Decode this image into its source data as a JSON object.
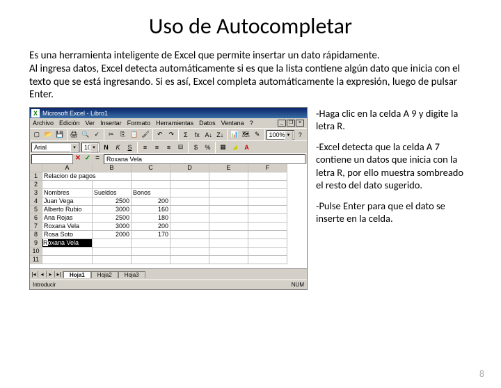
{
  "title": "Uso de Autocompletar",
  "intro": "Es una herramienta inteligente de Excel que permite insertar un dato rápidamente.\nAl ingresa datos, Excel detecta automáticamente si es que la lista contiene algún dato que inicia con el texto que se está ingresando. Si es así, Excel completa automáticamente la expresión, luego de pulsar Enter.",
  "notes": {
    "n1": "-Haga clic en la celda A 9 y digite la letra R.",
    "n2": "-Excel detecta que la celda A 7 contiene un datos que inicia con la letra R, por ello muestra sombreado el resto del dato sugerido.",
    "n3": "-Pulse Enter para que el dato se inserte en la celda."
  },
  "page": "8",
  "excel": {
    "titlebar": "Microsoft Excel - Libro1",
    "menu": [
      "Archivo",
      "Edición",
      "Ver",
      "Insertar",
      "Formato",
      "Herramientas",
      "Datos",
      "Ventana",
      "?"
    ],
    "font": "Arial",
    "fontsize": "10",
    "formula": "Roxana Vela",
    "namebox": "",
    "cols": [
      "A",
      "B",
      "C",
      "D",
      "E",
      "F"
    ],
    "rows": [
      {
        "n": "1",
        "A": "Relacion de pagos"
      },
      {
        "n": "2"
      },
      {
        "n": "3",
        "A": "Nombres",
        "B": "Sueldos",
        "C": "Bonos"
      },
      {
        "n": "4",
        "A": "Juan Vega",
        "B": "2500",
        "C": "200"
      },
      {
        "n": "5",
        "A": "Alberto Rubio",
        "B": "3000",
        "C": "160"
      },
      {
        "n": "6",
        "A": "Ana Rojas",
        "B": "2500",
        "C": "180"
      },
      {
        "n": "7",
        "A": "Roxana Vela",
        "B": "3000",
        "C": "200"
      },
      {
        "n": "8",
        "A": "Rosa Soto",
        "B": "2000",
        "C": "170"
      },
      {
        "n": "9",
        "A_typed": "R",
        "A_suggest": "oxana Vela"
      },
      {
        "n": "10"
      },
      {
        "n": "11"
      }
    ],
    "tabs": [
      "Hoja1",
      "Hoja2",
      "Hoja3"
    ],
    "status_left": "Introducir",
    "status_right": "NUM"
  }
}
